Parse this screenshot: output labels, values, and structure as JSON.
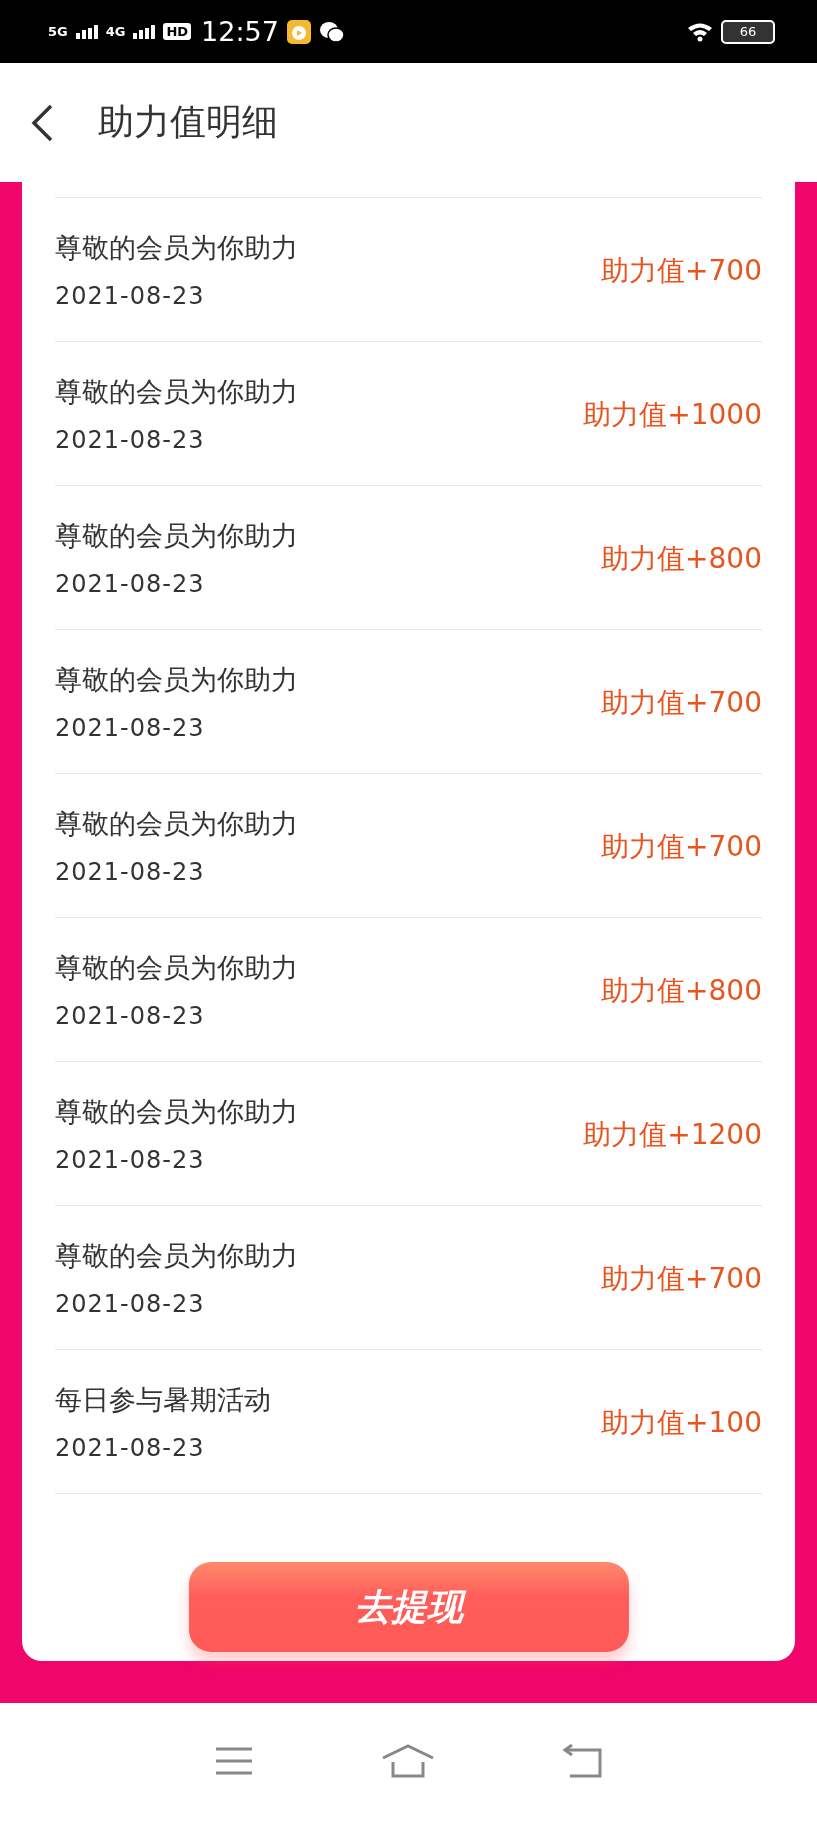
{
  "status_bar": {
    "signal_1": "5G",
    "signal_2": "4G",
    "hd": "HD",
    "time": "12:57",
    "battery": "66"
  },
  "header": {
    "title": "助力值明细"
  },
  "records": [
    {
      "title": "尊敬的会员为你助力",
      "date": "2021-08-23",
      "amount": "助力值+700"
    },
    {
      "title": "尊敬的会员为你助力",
      "date": "2021-08-23",
      "amount": "助力值+1000"
    },
    {
      "title": "尊敬的会员为你助力",
      "date": "2021-08-23",
      "amount": "助力值+800"
    },
    {
      "title": "尊敬的会员为你助力",
      "date": "2021-08-23",
      "amount": "助力值+700"
    },
    {
      "title": "尊敬的会员为你助力",
      "date": "2021-08-23",
      "amount": "助力值+700"
    },
    {
      "title": "尊敬的会员为你助力",
      "date": "2021-08-23",
      "amount": "助力值+800"
    },
    {
      "title": "尊敬的会员为你助力",
      "date": "2021-08-23",
      "amount": "助力值+1200"
    },
    {
      "title": "尊敬的会员为你助力",
      "date": "2021-08-23",
      "amount": "助力值+700"
    },
    {
      "title": "每日参与暑期活动",
      "date": "2021-08-23",
      "amount": "助力值+100"
    }
  ],
  "withdraw_button": "去提现"
}
